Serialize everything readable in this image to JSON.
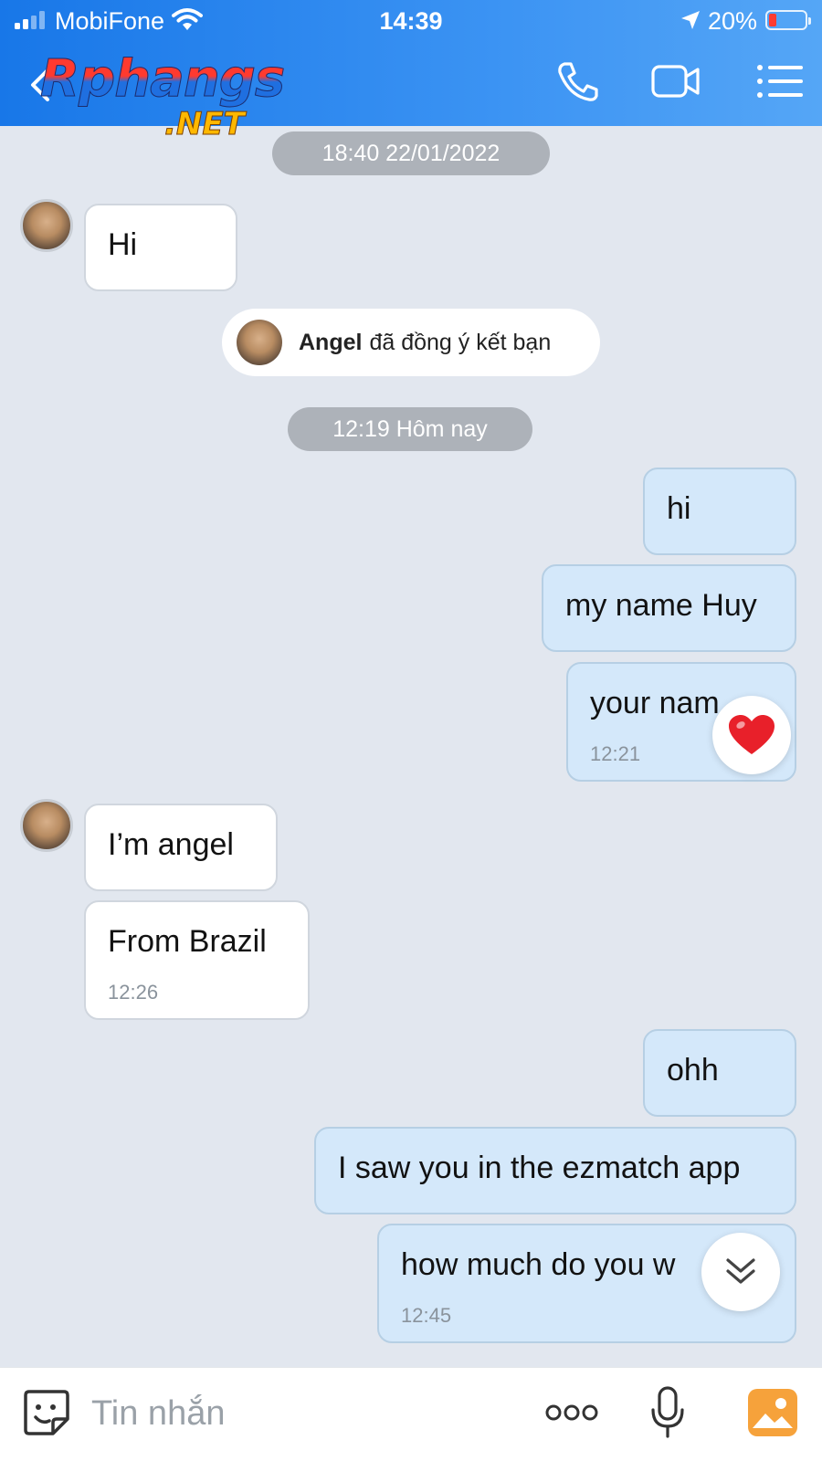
{
  "status_bar": {
    "carrier": "MobiFone",
    "time": "14:39",
    "battery": "20%",
    "battery_level": 0.2
  },
  "header": {
    "logo_line1": "Rphangs",
    "logo_line2": ".NET",
    "icons": [
      "back-icon",
      "phone-icon",
      "video-icon",
      "list-icon"
    ]
  },
  "chat": {
    "date_1": "18:40 22/01/2022",
    "msg_hi": "Hi",
    "system_name": "Angel",
    "system_text": "đã đồng ý kết bạn",
    "date_2": "12:19 Hôm nay",
    "msg_hi_out": "hi",
    "msg_name": "my name Huy",
    "msg_your_name": "your nam",
    "ts_1": "12:21",
    "msg_angel": "I’m angel",
    "msg_brazil": "From Brazil",
    "ts_2": "12:26",
    "msg_ohh": "ohh",
    "msg_ezmatch": "I saw you in the ezmatch app",
    "msg_howmuch": "how much do you w",
    "ts_3": "12:45",
    "reaction": "heart"
  },
  "input": {
    "placeholder": "Tin nhắn"
  },
  "colors": {
    "header_gradient_start": "#1877e8",
    "header_gradient_end": "#55a6f6",
    "outgoing_bubble": "#d4e8fa",
    "incoming_bubble": "#ffffff",
    "chat_background": "#e2e7ef"
  }
}
